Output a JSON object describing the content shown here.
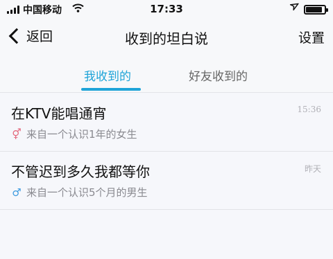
{
  "status_bar": {
    "carrier": "中国移动",
    "time": "17:33",
    "battery_level": 0.9
  },
  "nav": {
    "back_label": "返回",
    "title": "收到的坦白说",
    "settings_label": "设置"
  },
  "tabs": [
    {
      "label": "我收到的",
      "active": true
    },
    {
      "label": "好友收到的",
      "active": false
    }
  ],
  "messages": [
    {
      "title": "在KTV能唱通宵",
      "time": "15:36",
      "gender": "female",
      "subtitle": "来自一个认识1年的女生"
    },
    {
      "title": "不管迟到多久我都等你",
      "time": "昨天",
      "gender": "male",
      "subtitle": "来自一个认识5个月的男生"
    }
  ],
  "colors": {
    "accent": "#1fa4d8",
    "female": "#e46a7e",
    "male": "#3d9be0"
  }
}
